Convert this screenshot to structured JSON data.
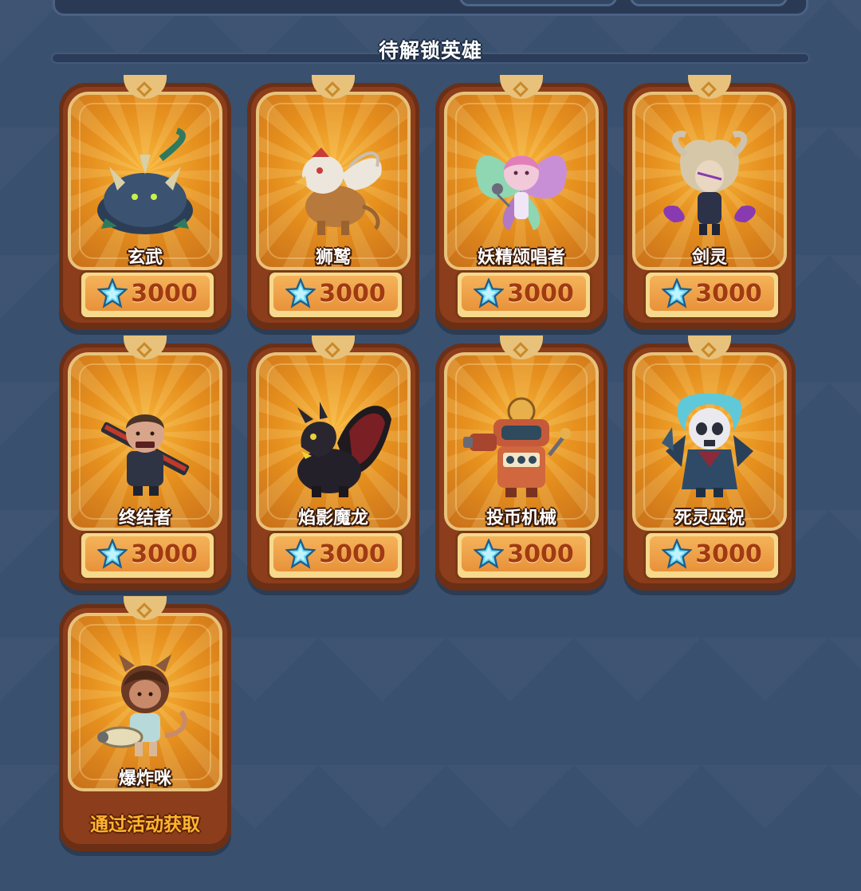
{
  "section": {
    "title": "待解锁英雄"
  },
  "currency_icon": "crystal-gem-icon",
  "colors": {
    "background": "#3a506f",
    "card_gold": "#e6901e",
    "card_frame": "#6b2f16",
    "price_text": "#a13a12",
    "obtain_text": "#ffb52e"
  },
  "heroes": [
    {
      "name": "玄武",
      "price": "3000",
      "figure_icon": "xuanwu-tortoise-icon"
    },
    {
      "name": "狮鹫",
      "price": "3000",
      "figure_icon": "griffin-icon"
    },
    {
      "name": "妖精颂唱者",
      "price": "3000",
      "figure_icon": "fairy-singer-icon"
    },
    {
      "name": "剑灵",
      "price": "3000",
      "figure_icon": "sword-spirit-icon"
    },
    {
      "name": "终结者",
      "price": "3000",
      "figure_icon": "terminator-icon"
    },
    {
      "name": "焰影魔龙",
      "price": "3000",
      "figure_icon": "shadow-dragon-icon"
    },
    {
      "name": "投币机械",
      "price": "3000",
      "figure_icon": "slot-machine-robot-icon"
    },
    {
      "name": "死灵巫祝",
      "price": "3000",
      "figure_icon": "necromancer-skull-icon"
    },
    {
      "name": "爆炸咪",
      "obtain": "通过活动获取",
      "figure_icon": "bomb-cat-icon"
    }
  ]
}
